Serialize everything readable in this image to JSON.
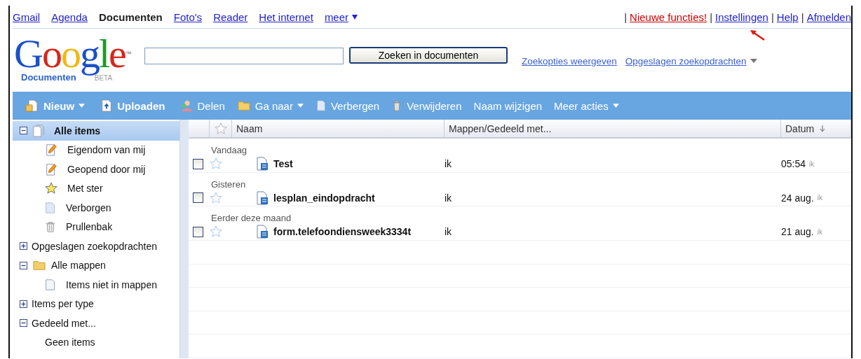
{
  "nav": {
    "links": [
      {
        "label": "Gmail",
        "selected": false
      },
      {
        "label": "Agenda",
        "selected": false
      },
      {
        "label": "Documenten",
        "selected": true
      },
      {
        "label": "Foto's",
        "selected": false
      },
      {
        "label": "Reader",
        "selected": false
      },
      {
        "label": "Het internet",
        "selected": false
      },
      {
        "label": "meer",
        "selected": false
      }
    ],
    "right_links": [
      {
        "sep": "|",
        "label": "Nieuwe functies!",
        "kind": "alert"
      },
      {
        "sep": "|",
        "label": "Instellingen",
        "kind": "link"
      },
      {
        "sep": "|",
        "label": "Help",
        "kind": "link"
      },
      {
        "sep": "|",
        "label": "Afmelden",
        "kind": "link"
      }
    ]
  },
  "logo": {
    "letters": "Google",
    "tm": "™",
    "subtitle": "Documenten",
    "badge": "BETA"
  },
  "search": {
    "button": "Zoeken in documenten",
    "links": [
      {
        "label": "Zoekopties weergeven",
        "caret": false
      },
      {
        "label": "Opgeslagen zoekopdrachten",
        "caret": true
      }
    ]
  },
  "toolbar": [
    {
      "label": "Nieuw",
      "kind": "new",
      "caret": true,
      "bold": true
    },
    {
      "label": "Uploaden",
      "kind": "upload",
      "caret": false,
      "bold": true
    },
    {
      "label": "Delen",
      "kind": "share",
      "caret": false,
      "bold": false
    },
    {
      "label": "Ga naar",
      "kind": "folder",
      "caret": true,
      "bold": false
    },
    {
      "label": "Verbergen",
      "kind": "hidden",
      "caret": false,
      "bold": false
    },
    {
      "label": "Verwijderen",
      "kind": "trash",
      "caret": false,
      "bold": false
    },
    {
      "label": "Naam wijzigen",
      "kind": "text",
      "caret": false,
      "bold": false
    },
    {
      "label": "Meer acties",
      "kind": "text",
      "caret": true,
      "bold": false
    }
  ],
  "sidebar": {
    "items": [
      {
        "label": "Alle items",
        "kind": "docs",
        "expanded": true,
        "selected": true,
        "children": [
          {
            "label": "Eigendom van mij",
            "kind": "edit",
            "selected": false
          },
          {
            "label": "Geopend door mij",
            "kind": "edit",
            "selected": false
          },
          {
            "label": "Met ster",
            "kind": "star",
            "selected": false
          },
          {
            "label": "Verborgen",
            "kind": "hidden",
            "selected": false
          },
          {
            "label": "Prullenbak",
            "kind": "trash",
            "selected": false
          }
        ]
      },
      {
        "label": "Opgeslagen zoekopdrachten",
        "kind": "text",
        "expanded": false,
        "selected": false
      },
      {
        "label": "Alle mappen",
        "kind": "folder",
        "expanded": true,
        "selected": false,
        "children": [
          {
            "label": "Items niet in mappen",
            "kind": "doc",
            "selected": false
          }
        ]
      },
      {
        "label": "Items per type",
        "kind": "text",
        "expanded": false,
        "selected": false
      },
      {
        "label": "Gedeeld met...",
        "kind": "text",
        "expanded": true,
        "selected": false,
        "children": [
          {
            "label": "Geen items",
            "kind": "text",
            "selected": false
          }
        ]
      }
    ]
  },
  "table": {
    "columns": [
      "Naam",
      "Mappen/Gedeeld met...",
      "Datum"
    ],
    "groups": [
      {
        "label": "Vandaag",
        "rows": [
          {
            "name": "Test",
            "checked": false,
            "starred": false,
            "folder": "ik",
            "date": "05:54",
            "by": "ik"
          }
        ]
      },
      {
        "label": "Gisteren",
        "rows": [
          {
            "name": "lesplan_eindopdracht",
            "checked": false,
            "starred": false,
            "folder": "ik",
            "date": "24 aug.",
            "by": "ik"
          }
        ]
      },
      {
        "label": "Eerder deze maand",
        "rows": [
          {
            "name": "form.telefoondiensweek3334t",
            "checked": false,
            "starred": false,
            "folder": "ik",
            "date": "21 aug.",
            "by": "ik"
          }
        ]
      }
    ]
  }
}
